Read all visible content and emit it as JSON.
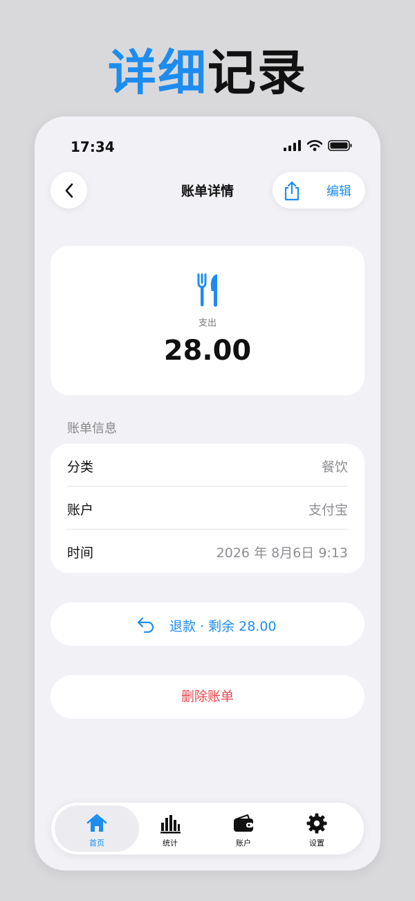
{
  "headline": {
    "accent": "详细",
    "rest": "记录"
  },
  "status_bar": {
    "time": "17:34"
  },
  "nav": {
    "title": "账单详情",
    "edit_label": "编辑"
  },
  "transaction": {
    "type": "支出",
    "amount": "28.00",
    "category_icon": "fork-knife-icon"
  },
  "info_section": {
    "title": "账单信息",
    "rows": [
      {
        "label": "分类",
        "value": "餐饮"
      },
      {
        "label": "账户",
        "value": "支付宝"
      },
      {
        "label": "时间",
        "value": "2026 年 8月6日 9:13"
      }
    ]
  },
  "actions": {
    "refund_label": "退款 · 剩余 28.00",
    "delete_label": "删除账单"
  },
  "tab_bar": {
    "tabs": [
      {
        "label": "首页",
        "icon": "home-icon",
        "active": true
      },
      {
        "label": "统计",
        "icon": "bar-chart-icon",
        "active": false
      },
      {
        "label": "账户",
        "icon": "wallet-icon",
        "active": false
      },
      {
        "label": "设置",
        "icon": "gear-icon",
        "active": false
      }
    ]
  },
  "colors": {
    "accent": "#1d8cf0",
    "danger": "#e5484d",
    "background": "#f1f1f6"
  }
}
